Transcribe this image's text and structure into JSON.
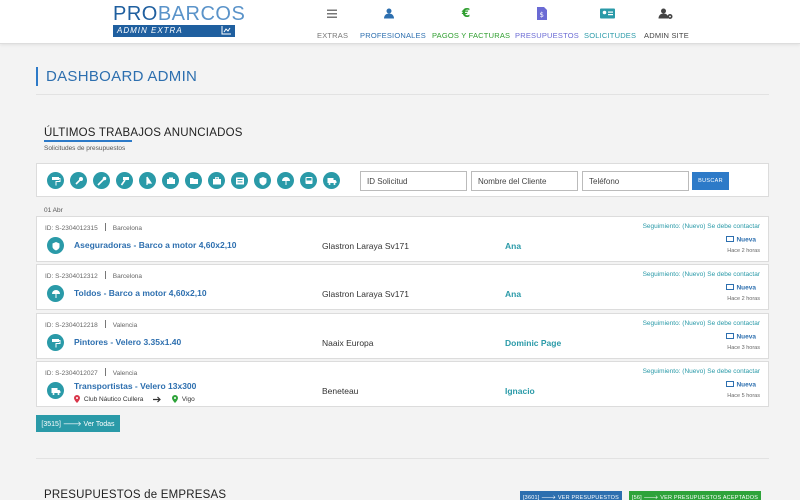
{
  "header": {
    "logo_primary": "PRO",
    "logo_secondary": "BARCOS",
    "logo_sub": "ADMIN EXTRA",
    "nav": [
      {
        "label": "EXTRAS",
        "icon": "list-icon",
        "color": "#777777"
      },
      {
        "label": "PROFESIONALES",
        "icon": "users-icon",
        "color": "#2d6faf"
      },
      {
        "label": "PAGOS Y FACTURAS",
        "icon": "euro-icon",
        "color": "#2e9e2e"
      },
      {
        "label": "PRESUPUESTOS",
        "icon": "document-icon",
        "color": "#6a6ad4"
      },
      {
        "label": "SOLICITUDES",
        "icon": "id-card-icon",
        "color": "#2a9aa8"
      },
      {
        "label": "ADMIN SITE",
        "icon": "user-gear-icon",
        "color": "#444444"
      }
    ]
  },
  "page": {
    "title": "DASHBOARD ADMIN"
  },
  "section1": {
    "title": "ÚLTIMOS TRABAJOS ANUNCIADOS",
    "subtitle": "Solicitudes de presupuestos"
  },
  "filters": {
    "category_icons": [
      "paint-roller-icon",
      "wrench-icon",
      "tools-icon",
      "hammer-icon",
      "sail-icon",
      "engine-icon",
      "folder-icon",
      "briefcase-icon",
      "electrical-panel-icon",
      "shield-icon",
      "parasol-icon",
      "bus-icon",
      "truck-icon"
    ],
    "id_placeholder": "ID Solicitud",
    "client_placeholder": "Nombre del Cliente",
    "phone_placeholder": "Teléfono",
    "search_label": "BUSCAR"
  },
  "date_group": "01 Abr",
  "requests": [
    {
      "id": "ID: S-2304012315",
      "city": "Barcelona",
      "title": "Aseguradoras - Barco a motor 4,60x2,10",
      "boat": "Glastron Laraya Sv171",
      "client": "Ana",
      "followup": "Seguimiento: (Nuevo) Se debe contactar",
      "status": "Nueva",
      "time": "Hace 2 horas",
      "icon": "shield-icon"
    },
    {
      "id": "ID: S-2304012312",
      "city": "Barcelona",
      "title": "Toldos - Barco a motor 4,60x2,10",
      "boat": "Glastron Laraya Sv171",
      "client": "Ana",
      "followup": "Seguimiento: (Nuevo) Se debe contactar",
      "status": "Nueva",
      "time": "Hace 2 horas",
      "icon": "parasol-icon"
    },
    {
      "id": "ID: S-2304012218",
      "city": "Valencia",
      "title": "Pintores - Velero 3.35x1.40",
      "boat": "Naaix Europa",
      "client": "Dominic Page",
      "followup": "Seguimiento: (Nuevo) Se debe contactar",
      "status": "Nueva",
      "time": "Hace 3 horas",
      "icon": "paint-roller-icon"
    },
    {
      "id": "ID: S-2304012027",
      "city": "Valencia",
      "title": "Transportistas - Velero 13x300",
      "boat": "Beneteau",
      "client": "Ignacio",
      "followup": "Seguimiento: (Nuevo) Se debe contactar",
      "status": "Nueva",
      "time": "Hace 5 horas",
      "icon": "truck-icon",
      "route_from": "Club Náutico Cullera",
      "route_to": "Vigo"
    }
  ],
  "view_all_label": "[3515] 🡒 Ver Todas",
  "section2": {
    "title": "PRESUPUESTOS de EMPRESAS",
    "btn_presupuestos": "[3601] 🡒 VER PRESUPUESTOS",
    "btn_aceptados": "[56] 🡒 VER PRESUPUESTOS ACEPTADOS"
  },
  "colors": {
    "brand": "#1f5f9f",
    "teal": "#2a9aa8",
    "link": "#2d6faf",
    "green": "#2ea33a"
  }
}
